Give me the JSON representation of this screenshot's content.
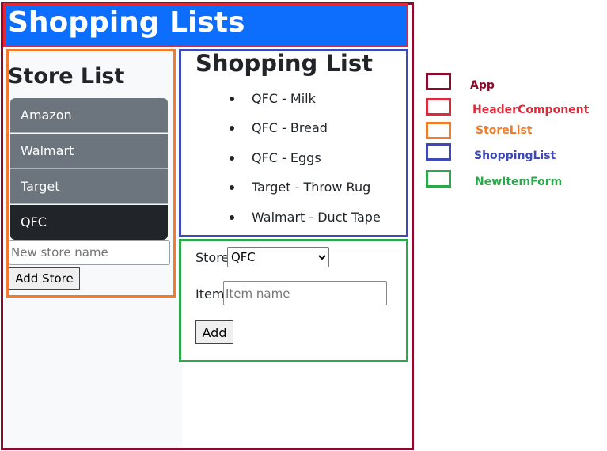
{
  "header": {
    "title": "Shopping Lists"
  },
  "store_list": {
    "title": "Store List",
    "stores": [
      {
        "name": "Amazon",
        "active": false
      },
      {
        "name": "Walmart",
        "active": false
      },
      {
        "name": "Target",
        "active": false
      },
      {
        "name": "QFC",
        "active": true
      }
    ],
    "new_store_placeholder": "New store name",
    "add_store_label": "Add Store"
  },
  "shopping_list": {
    "title": "Shopping List",
    "items": [
      "QFC - Milk",
      "QFC - Bread",
      "QFC - Eggs",
      "Target - Throw Rug",
      "Walmart - Duct Tape"
    ]
  },
  "new_item_form": {
    "store_label": "Store",
    "selected_store": "QFC",
    "item_label": "Item",
    "item_placeholder": "Item name",
    "add_label": "Add"
  },
  "legend": [
    {
      "label": "App",
      "color": "#8a0b2b"
    },
    {
      "label": "HeaderComponent",
      "color": "#dc2a3b"
    },
    {
      "label": "StoreList",
      "color": "#f27c2b"
    },
    {
      "label": "ShoppingList",
      "color": "#3d49b6"
    },
    {
      "label": "NewItemForm",
      "color": "#2aa84a"
    }
  ],
  "colors": {
    "header_bg": "#0d6efd",
    "store_item_bg": "#6c757d",
    "store_item_active_bg": "#212529"
  }
}
